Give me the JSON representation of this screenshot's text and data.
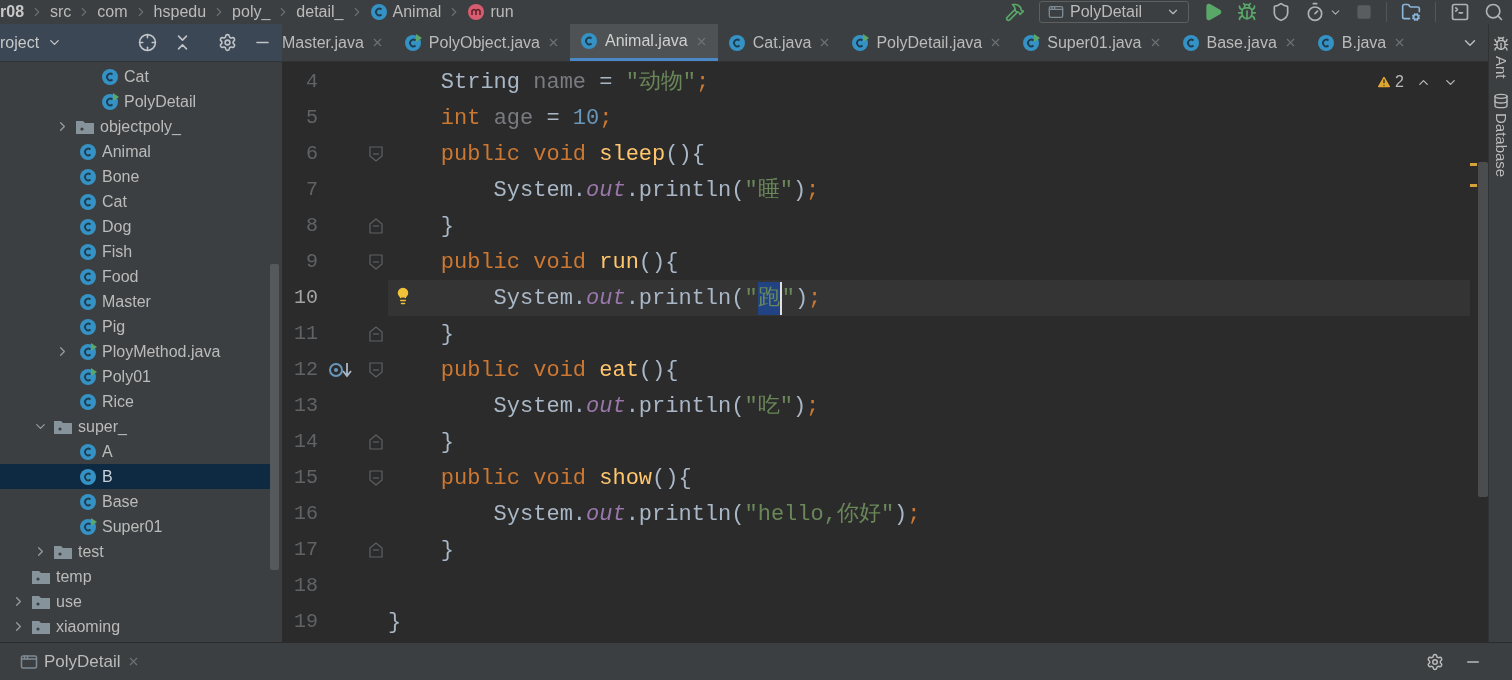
{
  "breadcrumbs": [
    {
      "text": "r08",
      "kind": "module"
    },
    {
      "text": "src",
      "kind": "folder"
    },
    {
      "text": "com",
      "kind": "folder"
    },
    {
      "text": "hspedu",
      "kind": "folder"
    },
    {
      "text": "poly_",
      "kind": "folder"
    },
    {
      "text": "detail_",
      "kind": "folder"
    },
    {
      "text": "Animal",
      "kind": "class"
    },
    {
      "text": "run",
      "kind": "method"
    }
  ],
  "run_config": "PolyDetail",
  "project_panel": {
    "title": "roject"
  },
  "tree": [
    {
      "children": [
        {
          "children": [
            {
              "children": [
                {
                  "label": "Cat",
                  "kind": "class",
                  "selected": false
                },
                {
                  "label": "PolyDetail",
                  "kind": "runnable",
                  "selected": false
                }
              ]
            },
            {
              "label": "objectpoly_",
              "kind": "folder",
              "expanded": false,
              "selected": false
            },
            {
              "label": "Animal",
              "kind": "class",
              "selected": false
            },
            {
              "label": "Bone",
              "kind": "class",
              "selected": false
            },
            {
              "label": "Cat",
              "kind": "class",
              "selected": false
            },
            {
              "label": "Dog",
              "kind": "class",
              "selected": false
            },
            {
              "label": "Fish",
              "kind": "class",
              "selected": false
            },
            {
              "label": "Food",
              "kind": "class",
              "selected": false
            },
            {
              "label": "Master",
              "kind": "class",
              "selected": false
            },
            {
              "label": "Pig",
              "kind": "class",
              "selected": false
            },
            {
              "label": "PloyMethod.java",
              "kind": "runnable",
              "expanded": false,
              "selected": false
            },
            {
              "label": "Poly01",
              "kind": "runnable",
              "selected": false
            },
            {
              "label": "Rice",
              "kind": "class",
              "selected": false
            }
          ]
        },
        {
          "label": "super_",
          "kind": "folder",
          "expanded": true,
          "selected": false,
          "children": [
            {
              "label": "A",
              "kind": "class",
              "selected": false
            },
            {
              "label": "B",
              "kind": "class",
              "selected": true
            },
            {
              "label": "Base",
              "kind": "class",
              "selected": false
            },
            {
              "label": "Super01",
              "kind": "runnable",
              "selected": false
            }
          ]
        },
        {
          "label": "test",
          "kind": "folder",
          "expanded": false,
          "selected": false
        }
      ]
    },
    {
      "label": "temp",
      "kind": "folder",
      "selected": false
    },
    {
      "label": "use",
      "kind": "folder",
      "expanded": false,
      "selected": false
    },
    {
      "label": "xiaoming",
      "kind": "folder",
      "expanded": false,
      "selected": false
    }
  ],
  "tabs": [
    {
      "label": "Master.java",
      "selected": false
    },
    {
      "label": "PolyObject.java",
      "kind": "runnable",
      "selected": false
    },
    {
      "label": "Animal.java",
      "kind": "class",
      "selected": true
    },
    {
      "label": "Cat.java",
      "kind": "class",
      "selected": false
    },
    {
      "label": "PolyDetail.java",
      "kind": "runnable",
      "selected": false
    },
    {
      "label": "Super01.java",
      "kind": "runnable",
      "selected": false
    },
    {
      "label": "Base.java",
      "kind": "class",
      "selected": false
    },
    {
      "label": "B.java",
      "kind": "class",
      "selected": false
    }
  ],
  "warnings": "2",
  "lines": [
    {
      "number": "4",
      "current": false,
      "tokens": [
        {
          "kind": "plain",
          "text": "    String "
        },
        {
          "kind": "unused",
          "text": "name"
        },
        {
          "kind": "plain",
          "text": " = "
        },
        {
          "kind": "string",
          "text": "\"动物\""
        },
        {
          "kind": "keyword",
          "text": ";"
        }
      ]
    },
    {
      "number": "5",
      "current": false,
      "tokens": [
        {
          "kind": "keyword",
          "text": "    int "
        },
        {
          "kind": "unused",
          "text": "age"
        },
        {
          "kind": "plain",
          "text": " = "
        },
        {
          "kind": "number",
          "text": "10"
        },
        {
          "kind": "keyword",
          "text": ";"
        }
      ]
    },
    {
      "number": "6",
      "current": false,
      "markers": [
        {
          "kind": "fold_start"
        }
      ],
      "tokens": [
        {
          "kind": "keyword",
          "text": "    public void "
        },
        {
          "kind": "method",
          "text": "sleep"
        },
        {
          "kind": "plain",
          "text": "(){"
        }
      ]
    },
    {
      "number": "7",
      "current": false,
      "tokens": [
        {
          "kind": "plain",
          "text": "        System."
        },
        {
          "kind": "field",
          "text": "out"
        },
        {
          "kind": "plain",
          "text": ".println("
        },
        {
          "kind": "string",
          "text": "\"睡\""
        },
        {
          "kind": "plain",
          "text": ")"
        },
        {
          "kind": "keyword",
          "text": ";"
        }
      ]
    },
    {
      "number": "8",
      "current": false,
      "markers": [
        {
          "kind": "fold_end"
        }
      ],
      "tokens": [
        {
          "kind": "plain",
          "text": "    }"
        }
      ]
    },
    {
      "number": "9",
      "current": false,
      "markers": [
        {
          "kind": "fold_start"
        }
      ],
      "tokens": [
        {
          "kind": "keyword",
          "text": "    public void "
        },
        {
          "kind": "method",
          "text": "run"
        },
        {
          "kind": "plain",
          "text": "(){"
        }
      ]
    },
    {
      "number": "10",
      "current": true,
      "markers": [
        {
          "kind": "bulb"
        }
      ],
      "tokens": [
        {
          "kind": "plain",
          "text": "        System."
        },
        {
          "kind": "field",
          "text": "out"
        },
        {
          "kind": "plain",
          "text": ".println("
        },
        {
          "kind": "string",
          "text": "\""
        },
        {
          "kind": "selection",
          "text": "跑"
        },
        {
          "kind": "string",
          "text": "\""
        },
        {
          "kind": "plain",
          "text": ")"
        },
        {
          "kind": "keyword",
          "text": ";"
        }
      ]
    },
    {
      "number": "11",
      "current": false,
      "markers": [
        {
          "kind": "fold_end"
        }
      ],
      "tokens": [
        {
          "kind": "plain",
          "text": "    }"
        }
      ]
    },
    {
      "number": "12",
      "current": false,
      "markers": [
        {
          "kind": "override"
        },
        {
          "kind": "fold_start"
        }
      ],
      "tokens": [
        {
          "kind": "keyword",
          "text": "    public void "
        },
        {
          "kind": "method",
          "text": "eat"
        },
        {
          "kind": "plain",
          "text": "(){"
        }
      ]
    },
    {
      "number": "13",
      "current": false,
      "tokens": [
        {
          "kind": "plain",
          "text": "        System."
        },
        {
          "kind": "field",
          "text": "out"
        },
        {
          "kind": "plain",
          "text": ".println("
        },
        {
          "kind": "string",
          "text": "\"吃\""
        },
        {
          "kind": "plain",
          "text": ")"
        },
        {
          "kind": "keyword",
          "text": ";"
        }
      ]
    },
    {
      "number": "14",
      "current": false,
      "markers": [
        {
          "kind": "fold_end"
        }
      ],
      "tokens": [
        {
          "kind": "plain",
          "text": "    }"
        }
      ]
    },
    {
      "number": "15",
      "current": false,
      "markers": [
        {
          "kind": "fold_start"
        }
      ],
      "tokens": [
        {
          "kind": "keyword",
          "text": "    public void "
        },
        {
          "kind": "method",
          "text": "show"
        },
        {
          "kind": "plain",
          "text": "(){"
        }
      ]
    },
    {
      "number": "16",
      "current": false,
      "tokens": [
        {
          "kind": "plain",
          "text": "        System."
        },
        {
          "kind": "field",
          "text": "out"
        },
        {
          "kind": "plain",
          "text": ".println("
        },
        {
          "kind": "string",
          "text": "\"hello,你好\""
        },
        {
          "kind": "plain",
          "text": ")"
        },
        {
          "kind": "keyword",
          "text": ";"
        }
      ]
    },
    {
      "number": "17",
      "current": false,
      "markers": [
        {
          "kind": "fold_end"
        }
      ],
      "tokens": [
        {
          "kind": "plain",
          "text": "    }"
        }
      ]
    },
    {
      "number": "18",
      "current": false
    },
    {
      "number": "19",
      "current": false,
      "tokens": [
        {
          "kind": "plain",
          "text": "}"
        }
      ]
    }
  ],
  "right_strip": [
    "Ant",
    "Database"
  ],
  "run_tab": "PolyDetail"
}
